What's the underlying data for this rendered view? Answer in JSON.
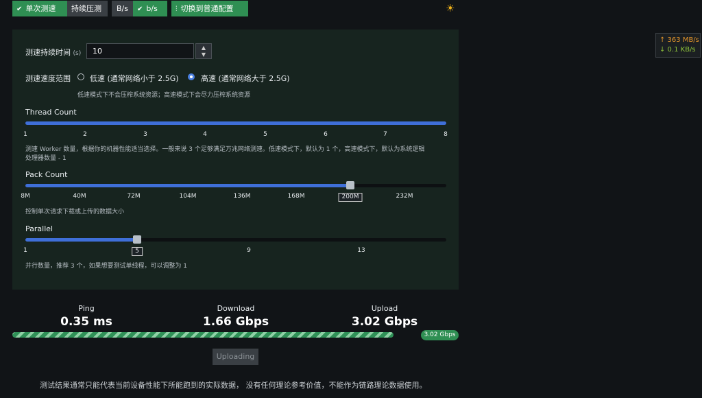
{
  "toolbar": {
    "single_test": "单次测速",
    "continuous_test": "持续压测",
    "unit_bytes": "B/s",
    "unit_bits": "b/s",
    "switch_config": "切换到普通配置"
  },
  "traffic": {
    "up": "↑ 363 MB/s",
    "down": "↓ 0.1 KB/s"
  },
  "settings": {
    "duration_label": "测速持续时间",
    "duration_unit": "(s)",
    "duration_value": "10",
    "speed_range_label": "测速速度范围",
    "low_speed": "低速 (通常网络小于 2.5G)",
    "high_speed": "高速 (通常网络大于 2.5G)",
    "speed_hint": "低速模式下不会压榨系统资源；高速模式下会尽力压榨系统资源",
    "selected_speed": "high"
  },
  "thread": {
    "label": "Thread Count",
    "ticks": [
      "1",
      "2",
      "3",
      "4",
      "5",
      "6",
      "7",
      "8"
    ],
    "value": 8,
    "min": 1,
    "max": 8,
    "hint_line1": "测速 Worker 数量，根据你的机器性能适当选择。一般来说 3 个足够满足万兆网络测速。低速模式下，默认为 1 个，高速模式下，默认为系统逻辑",
    "hint_line2": "处理器数量 - 1"
  },
  "pack": {
    "label": "Pack Count",
    "ticks": [
      "8M",
      "40M",
      "72M",
      "104M",
      "136M",
      "168M",
      "200M",
      "232M"
    ],
    "selected": "200M",
    "hint": "控制单次请求下载或上传的数据大小"
  },
  "parallel": {
    "label": "Parallel",
    "ticks": [
      "1",
      "5",
      "9",
      "13"
    ],
    "value": 5,
    "min": 1,
    "max": 16,
    "hint": "并行数量，推荐 3 个，如果想要测试单线程，可以调整为 1"
  },
  "results": {
    "ping_label": "Ping",
    "ping_value": "0.35 ms",
    "download_label": "Download",
    "download_value": "1.66 Gbps",
    "upload_label": "Upload",
    "upload_value": "3.02 Gbps",
    "progress_badge": "3.02 Gbps",
    "progress_fraction": 0.83,
    "button": "Uploading"
  },
  "footer": "测试结果通常只能代表当前设备性能下所能跑到的实际数据， 没有任何理论参考价值，不能作为链路理论数据使用。",
  "colors": {
    "accent_green": "#2f8f53",
    "accent_blue": "#3f6fd8",
    "panel_bg": "#17241f"
  }
}
